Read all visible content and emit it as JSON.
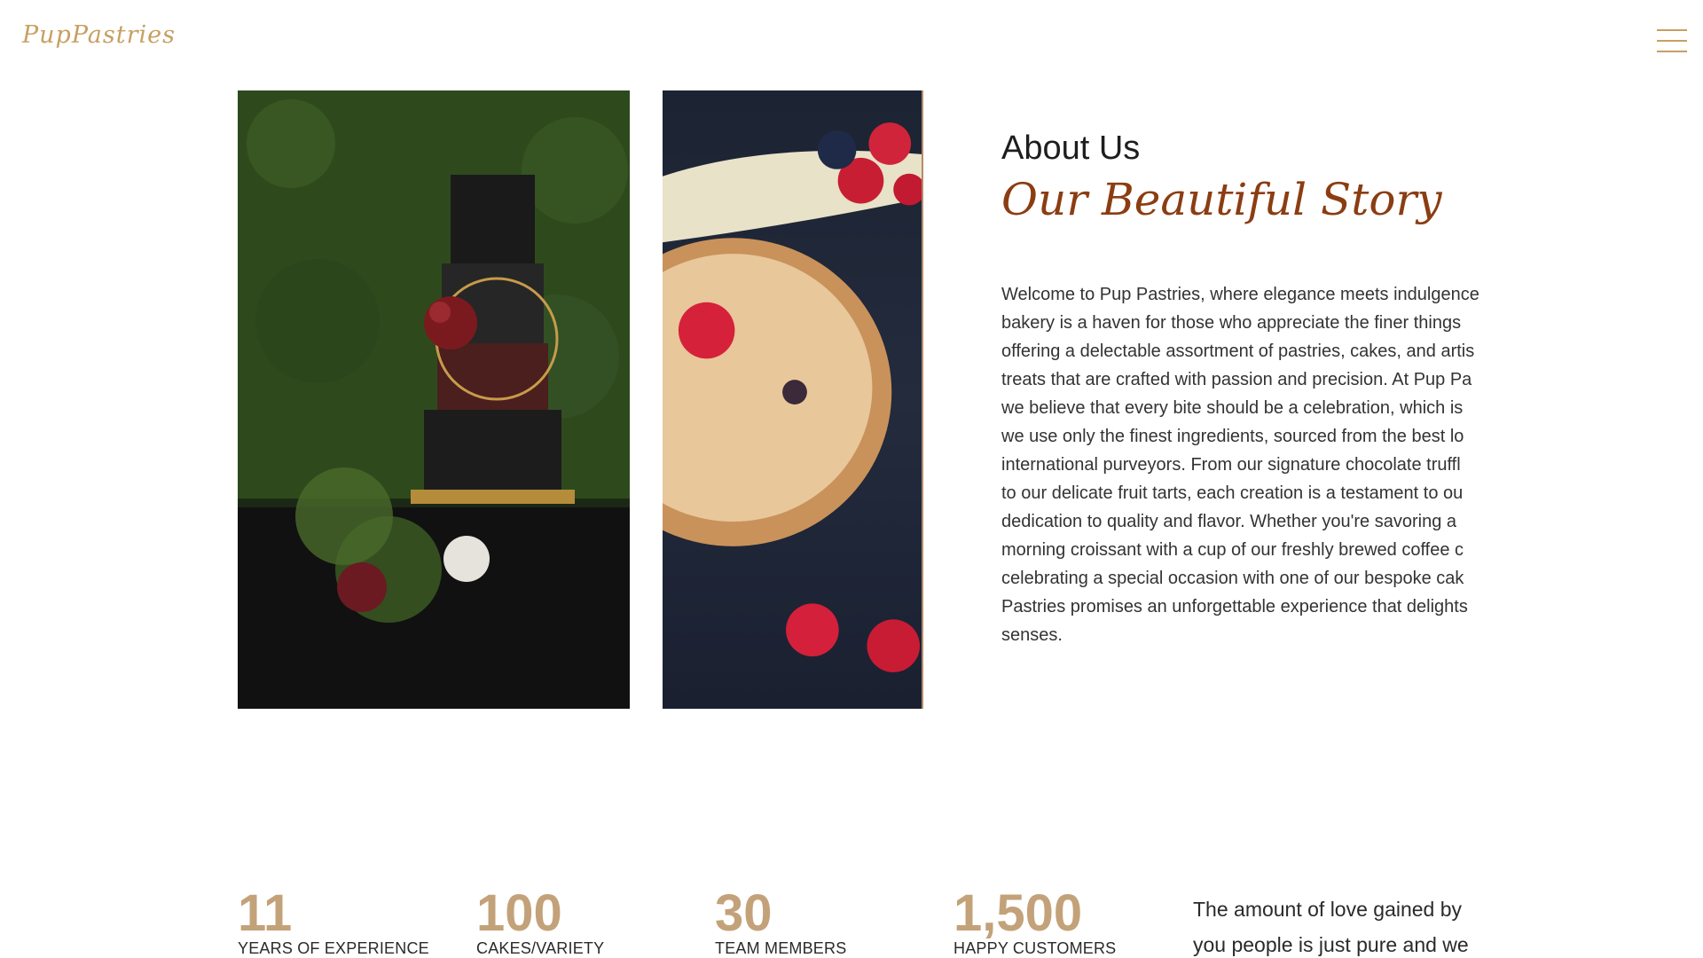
{
  "header": {
    "logo": "PupPastries",
    "menu_icon": "hamburger-menu-icon"
  },
  "gallery": {
    "cake_image": "tiered-black-cake-photo",
    "pie_image": "berry-crumble-tart-photo"
  },
  "about": {
    "heading": "About Us",
    "subheading": "Our Beautiful Story",
    "body": "Welcome to Pup Pastries, where elegance meets indulgence\nbakery is a haven for those who appreciate the finer things\noffering a delectable assortment of pastries, cakes, and artis\ntreats that are crafted with passion and precision. At Pup Pa\nwe believe that every bite should be a celebration, which is\nwe use only the finest ingredients, sourced from the best lo\ninternational purveyors. From our signature chocolate truffl\nto our delicate fruit tarts, each creation is a testament to ou\ndedication to quality and flavor. Whether you're savoring a\nmorning croissant with a cup of our freshly brewed coffee c\ncelebrating a special occasion with one of our bespoke cak\nPastries promises an unforgettable experience that delights\nsenses."
  },
  "stats": [
    {
      "value": "11",
      "label": "YEARS OF EXPERIENCE"
    },
    {
      "value": "100",
      "label": "CAKES/VARIETY"
    },
    {
      "value": "30",
      "label": "TEAM MEMBERS"
    },
    {
      "value": "1,500",
      "label": "HAPPY CUSTOMERS"
    }
  ],
  "stats_quote": "The amount of love gained by\nyou people is just pure and we",
  "colors": {
    "accent_gold": "#c6a062",
    "heading_brown": "#8b3d12",
    "stat_tan": "#c3a27a"
  }
}
